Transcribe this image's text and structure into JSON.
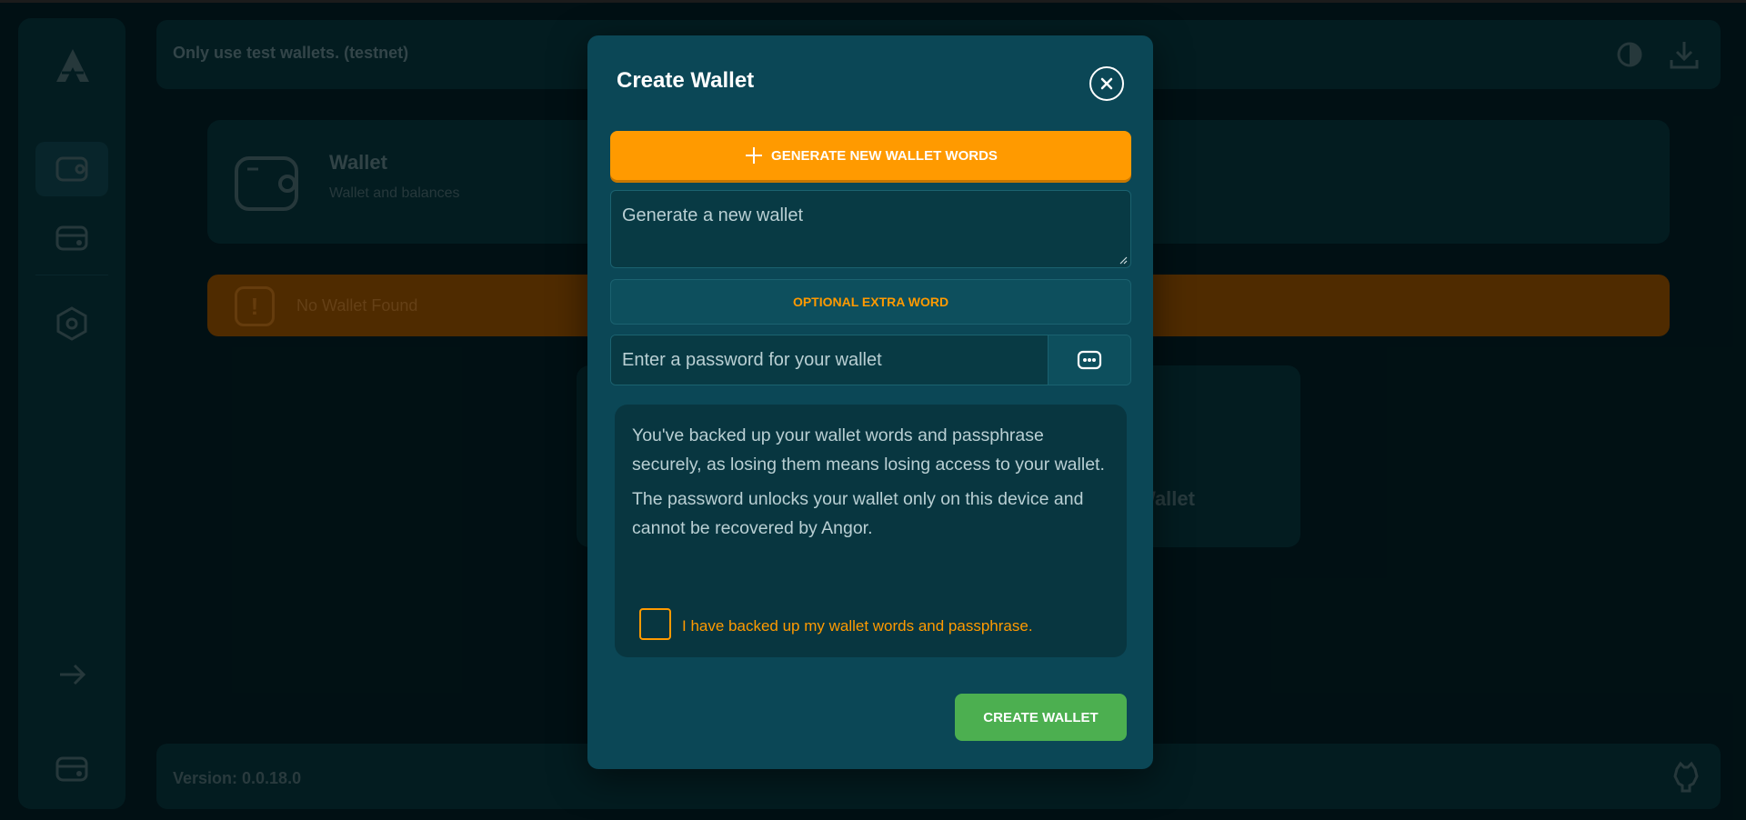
{
  "app": {
    "banner_text": "Only use test wallets. (testnet)",
    "wallet_card": {
      "title": "Wallet",
      "subtitle": "Wallet and balances"
    },
    "warning": {
      "text": "No Wallet Found"
    },
    "create_card": {
      "label": "Wallet"
    },
    "footer": {
      "version": "Version: 0.0.18.0"
    },
    "icons": {
      "logo": "angor-logo-icon",
      "sidebar": [
        "wallet-icon",
        "funds-icon",
        "settings-icon",
        "arrow-right-icon",
        "wallet-bottom-icon"
      ],
      "topbar": [
        "theme-toggle-icon",
        "download-icon"
      ],
      "footer": "github-icon"
    }
  },
  "modal": {
    "title": "Create Wallet",
    "close_icon": "close-icon",
    "generate_button": "GENERATE NEW WALLET WORDS",
    "words_placeholder": "Generate a new wallet",
    "extra_word_button": "OPTIONAL EXTRA WORD",
    "password_placeholder": "Enter a password for your wallet",
    "password_toggle_icon": "password-dots-icon",
    "info": {
      "paragraph1": "You've backed up your wallet words and passphrase securely, as losing them means losing access to your wallet.",
      "paragraph2": "The password unlocks your wallet only on this device and cannot be recovered by Angor."
    },
    "acknowledge_label": "I have backed up my wallet words and passphrase.",
    "acknowledge_checked": false,
    "create_button": "CREATE WALLET"
  },
  "colors": {
    "accent": "#ff9a00",
    "success": "#4caf50",
    "modal_bg": "#0b4756",
    "page_bg": "#021a1f"
  }
}
